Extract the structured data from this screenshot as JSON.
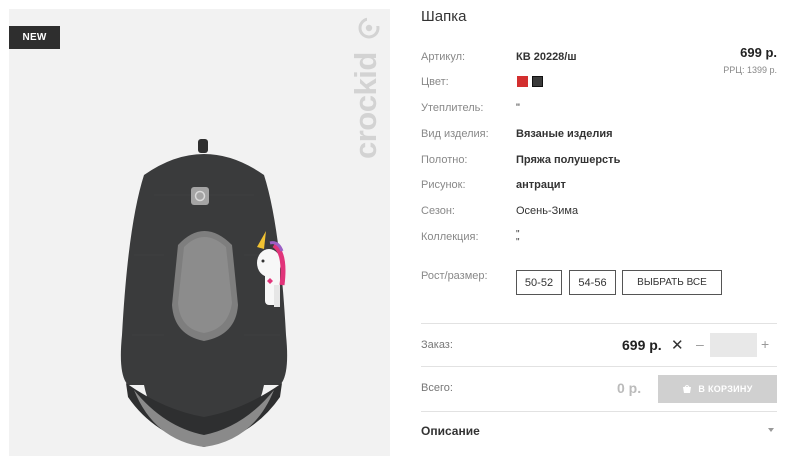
{
  "product": {
    "badge": "NEW",
    "brand": "crockid",
    "title": "Шапка",
    "price": "699 р.",
    "rrp": "РРЦ: 1399 р."
  },
  "specs": [
    {
      "label": "Артикул:",
      "value": "КВ 20228/ш"
    },
    {
      "label": "Цвет:",
      "value": ""
    },
    {
      "label": "Утеплитель:",
      "value": "\""
    },
    {
      "label": "Вид изделия:",
      "value": "Вязаные изделия"
    },
    {
      "label": "Полотно:",
      "value": "Пряжа полушерсть"
    },
    {
      "label": "Рисунок:",
      "value": "антрацит"
    },
    {
      "label": "Сезон:",
      "value": "Осень-Зима"
    },
    {
      "label": "Коллекция:",
      "value": "\"\n\""
    }
  ],
  "colors": [
    "#d32f2f",
    "#3a3a3a"
  ],
  "sizes": {
    "label": "Рост/размер:",
    "options": [
      "50-52",
      "54-56"
    ],
    "select_all": "ВЫБРАТЬ ВСЕ"
  },
  "order": {
    "label": "Заказ:",
    "price": "699 р.",
    "times": "✕",
    "minus": "–",
    "plus": "+",
    "quantity": ""
  },
  "total": {
    "label": "Всего:",
    "price": "0 р.",
    "cart_button": "В КОРЗИНУ"
  },
  "description": {
    "title": "Описание"
  }
}
